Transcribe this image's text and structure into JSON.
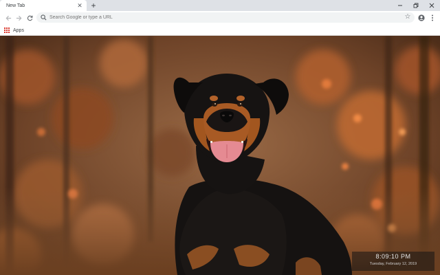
{
  "browser": {
    "tab_title": "New Tab",
    "tab_close_icon": "close-icon",
    "new_tab_icon": "plus-icon",
    "window_controls": [
      "minimize-icon",
      "restore-icon",
      "close-icon"
    ]
  },
  "toolbar": {
    "back_icon": "arrow-left-icon",
    "forward_icon": "arrow-right-icon",
    "reload_icon": "reload-icon",
    "omnibox_placeholder": "Search Google or type a URL",
    "star_icon": "star-icon",
    "profile_icon": "account-icon",
    "menu_icon": "more-vert-icon"
  },
  "bookmarks": {
    "apps_label": "Apps",
    "apps_icon": "apps-grid-icon"
  },
  "wallpaper": {
    "subject": "rottweiler-dog",
    "clock_time": "8:09:10 PM",
    "clock_date": "Tuesday, February 12, 2019"
  },
  "colors": {
    "tabstrip_bg": "#dee1e6",
    "omnibox_bg": "#f1f3f4",
    "apps_icon": "#d93025"
  }
}
